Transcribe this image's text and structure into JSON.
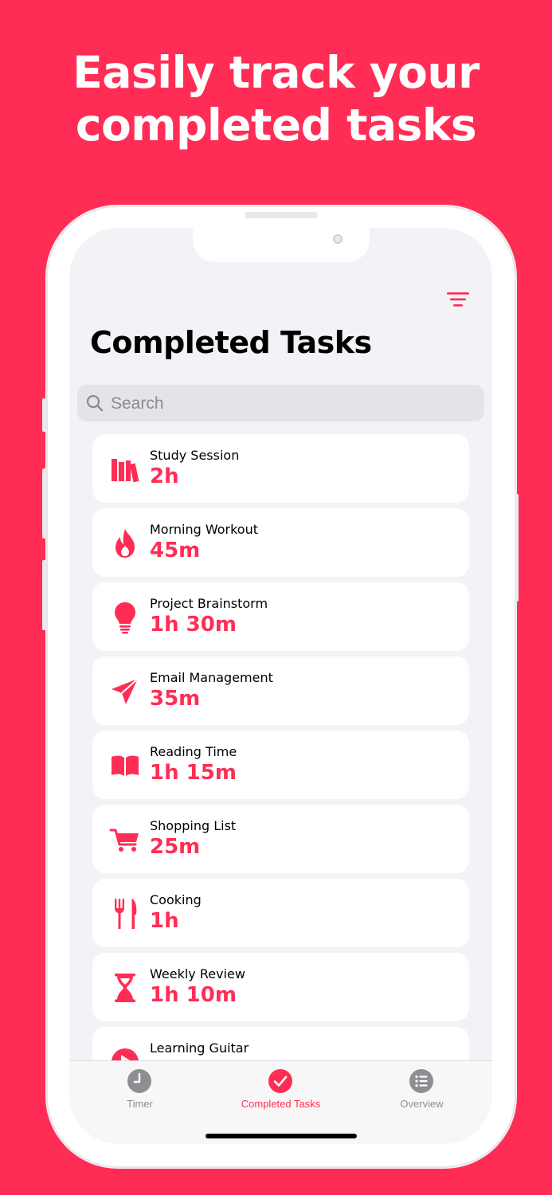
{
  "headline": {
    "line1": "Easily track your",
    "line2": "completed tasks"
  },
  "screen": {
    "title": "Completed Tasks",
    "search_placeholder": "Search",
    "tasks": [
      {
        "name": "Study Session",
        "duration": "2h",
        "icon": "books-icon"
      },
      {
        "name": "Morning Workout",
        "duration": "45m",
        "icon": "flame-icon"
      },
      {
        "name": "Project Brainstorm",
        "duration": "1h 30m",
        "icon": "lightbulb-icon"
      },
      {
        "name": "Email Management",
        "duration": "35m",
        "icon": "paperplane-icon"
      },
      {
        "name": "Reading Time",
        "duration": "1h 15m",
        "icon": "book-icon"
      },
      {
        "name": "Shopping List",
        "duration": "25m",
        "icon": "cart-icon"
      },
      {
        "name": "Cooking",
        "duration": "1h",
        "icon": "fork-knife-icon"
      },
      {
        "name": "Weekly Review",
        "duration": "1h 10m",
        "icon": "hourglass-icon"
      },
      {
        "name": "Learning Guitar",
        "duration": "",
        "icon": "play-icon"
      }
    ]
  },
  "tabbar": {
    "tabs": [
      {
        "label": "Timer",
        "icon": "clock-icon",
        "active": false
      },
      {
        "label": "Completed Tasks",
        "icon": "checkmark-circle-icon",
        "active": true
      },
      {
        "label": "Overview",
        "icon": "list-icon",
        "active": false
      }
    ]
  },
  "colors": {
    "accent": "#FF2D55",
    "background": "#F2F2F7",
    "inactive": "#8E8E93"
  }
}
